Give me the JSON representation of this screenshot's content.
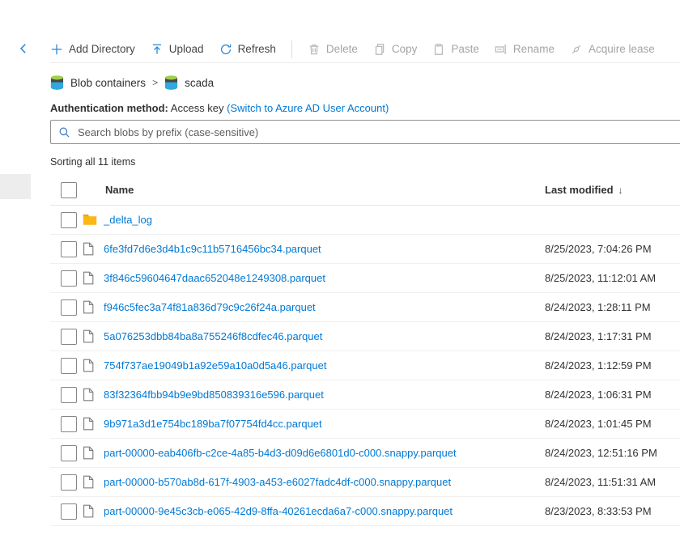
{
  "colors": {
    "accent_blue": "#2b88d8",
    "link_blue": "#0078d4",
    "text_dark": "#323130",
    "disabled_gray": "#a6a4a2",
    "folder_yellow": "#fcb714"
  },
  "nav": {
    "back_icon": "chevron-left"
  },
  "toolbar": {
    "items": [
      {
        "label": "Add Directory",
        "icon": "plus-icon",
        "enabled": true
      },
      {
        "label": "Upload",
        "icon": "upload-icon",
        "enabled": true
      },
      {
        "label": "Refresh",
        "icon": "refresh-icon",
        "enabled": true
      },
      {
        "label": "Delete",
        "icon": "trash-icon",
        "enabled": false,
        "separator_before": true
      },
      {
        "label": "Copy",
        "icon": "copy-icon",
        "enabled": false
      },
      {
        "label": "Paste",
        "icon": "paste-icon",
        "enabled": false
      },
      {
        "label": "Rename",
        "icon": "rename-icon",
        "enabled": false
      },
      {
        "label": "Acquire lease",
        "icon": "lease-icon",
        "enabled": false
      }
    ]
  },
  "breadcrumb": {
    "root": "Blob containers",
    "separator": ">",
    "current": "scada"
  },
  "auth": {
    "label": "Authentication method:",
    "value": "Access key",
    "link": "(Switch to Azure AD User Account)"
  },
  "search": {
    "placeholder": "Search blobs by prefix (case-sensitive)"
  },
  "status": {
    "sorting_text": "Sorting all 11 items"
  },
  "table": {
    "header": {
      "name": "Name",
      "last_modified": "Last modified",
      "sort_arrow": "↓"
    },
    "rows": [
      {
        "name": "_delta_log",
        "type": "folder",
        "last_modified": ""
      },
      {
        "name": "6fe3fd7d6e3d4b1c9c11b5716456bc34.parquet",
        "type": "file",
        "last_modified": "8/25/2023, 7:04:26 PM"
      },
      {
        "name": "3f846c59604647daac652048e1249308.parquet",
        "type": "file",
        "last_modified": "8/25/2023, 11:12:01 AM"
      },
      {
        "name": "f946c5fec3a74f81a836d79c9c26f24a.parquet",
        "type": "file",
        "last_modified": "8/24/2023, 1:28:11 PM"
      },
      {
        "name": "5a076253dbb84ba8a755246f8cdfec46.parquet",
        "type": "file",
        "last_modified": "8/24/2023, 1:17:31 PM"
      },
      {
        "name": "754f737ae19049b1a92e59a10a0d5a46.parquet",
        "type": "file",
        "last_modified": "8/24/2023, 1:12:59 PM"
      },
      {
        "name": "83f32364fbb94b9e9bd850839316e596.parquet",
        "type": "file",
        "last_modified": "8/24/2023, 1:06:31 PM"
      },
      {
        "name": "9b971a3d1e754bc189ba7f07754fd4cc.parquet",
        "type": "file",
        "last_modified": "8/24/2023, 1:01:45 PM"
      },
      {
        "name": "part-00000-eab406fb-c2ce-4a85-b4d3-d09d6e6801d0-c000.snappy.parquet",
        "type": "file",
        "last_modified": "8/24/2023, 12:51:16 PM"
      },
      {
        "name": "part-00000-b570ab8d-617f-4903-a453-e6027fadc4df-c000.snappy.parquet",
        "type": "file",
        "last_modified": "8/24/2023, 11:51:31 AM"
      },
      {
        "name": "part-00000-9e45c3cb-e065-42d9-8ffa-40261ecda6a7-c000.snappy.parquet",
        "type": "file",
        "last_modified": "8/23/2023, 8:33:53 PM"
      }
    ]
  }
}
